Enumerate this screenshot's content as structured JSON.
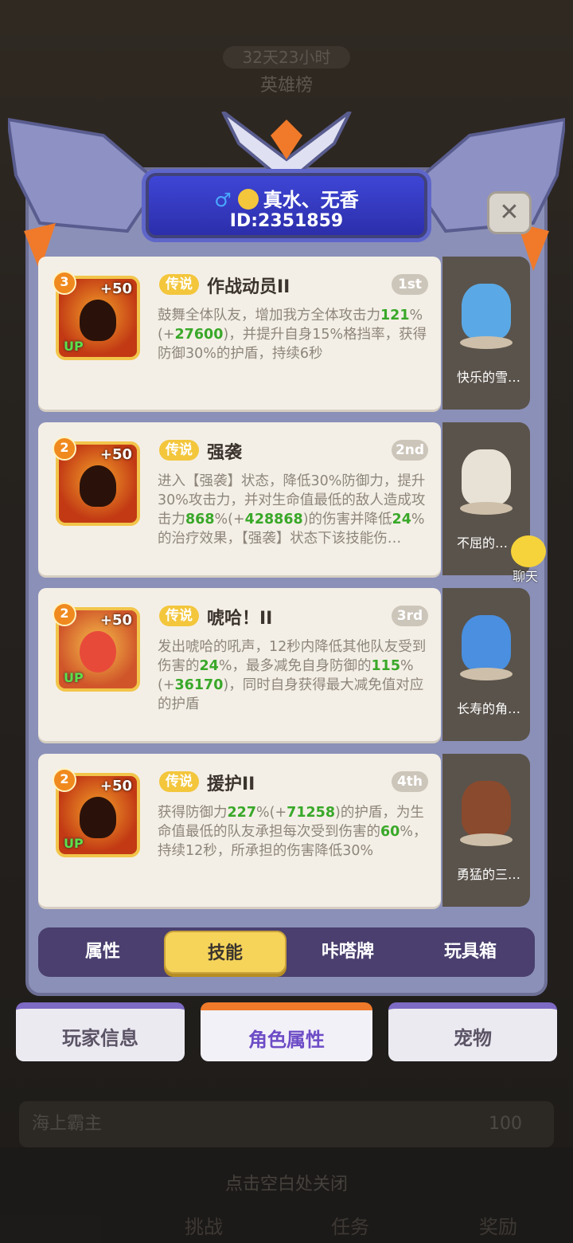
{
  "background": {
    "timer": "32天23小时",
    "ranking_title": "英雄榜",
    "row_title": "海上霸主",
    "row_value": "100",
    "dismiss_hint": "点击空白处关闭",
    "nav": [
      "挑战",
      "任务",
      "奖励"
    ]
  },
  "profile": {
    "gender_symbol": "♂",
    "name": "真水、无香",
    "id": "ID:2351859"
  },
  "close_label": "✕",
  "skills": [
    {
      "level": "3",
      "bonus": "+50",
      "up": "UP",
      "tag": "传说",
      "name": "作战动员II",
      "rank": "1st",
      "desc": [
        "鼓舞全体队友，增加我方全体攻击力",
        "121",
        "%(+",
        "27600",
        ")，并提升自身15%格挡率，获得防御30%的护盾，持续6秒"
      ]
    },
    {
      "level": "2",
      "bonus": "+50",
      "up": "",
      "tag": "传说",
      "name": "强袭",
      "rank": "2nd",
      "desc": [
        "进入【强袭】状态，降低30%防御力，提升30%攻击力，并对生命值最低的敌人造成攻击力",
        "868",
        "%(+",
        "428868",
        ")的伤害并降低",
        "24",
        "%的治疗效果，【强袭】状态下该技能伤…"
      ]
    },
    {
      "level": "2",
      "bonus": "+50",
      "up": "UP",
      "tag": "传说",
      "name": "唬哈！II",
      "rank": "3rd",
      "desc": [
        "发出唬哈的吼声，12秒内降低其他队友受到伤害的",
        "24",
        "%，最多减免自身防御的",
        "115",
        "%(+",
        "36170",
        ")，同时自身获得最大减免值对应的护盾"
      ]
    },
    {
      "level": "2",
      "bonus": "+50",
      "up": "UP",
      "tag": "传说",
      "name": "援护II",
      "rank": "4th",
      "desc": [
        "获得防御力",
        "227",
        "%(+",
        "71258",
        ")的护盾，为生命值最低的队友承担每次受到伤害的",
        "60",
        "%，持续12秒，所承担的伤害降低30%"
      ]
    }
  ],
  "pets": [
    {
      "name": "快乐的雪…",
      "color": "#5aa9e6"
    },
    {
      "name": "不屈的…",
      "color": "#e8e2d6"
    },
    {
      "name": "长寿的角…",
      "color": "#4a8fe0"
    },
    {
      "name": "勇猛的三…",
      "color": "#8a4a2e"
    }
  ],
  "chat_label": "聊天",
  "sub_tabs": [
    "属性",
    "技能",
    "咔嗒牌",
    "玩具箱"
  ],
  "active_sub_tab": "技能",
  "main_tabs": [
    "玩家信息",
    "角色属性",
    "宠物"
  ],
  "active_main_tab": "角色属性",
  "colors": {
    "accent_green": "#39a829",
    "tag_gold": "#f3c63c",
    "panel_purple": "#4a3f6e"
  }
}
